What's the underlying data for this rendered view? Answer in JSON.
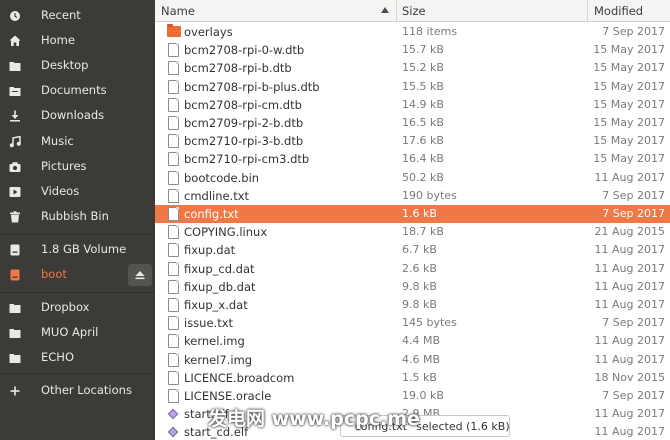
{
  "sidebar": {
    "items": [
      {
        "label": "Recent",
        "icon": "clock-icon"
      },
      {
        "label": "Home",
        "icon": "home-icon"
      },
      {
        "label": "Desktop",
        "icon": "folder-icon"
      },
      {
        "label": "Documents",
        "icon": "document-icon"
      },
      {
        "label": "Downloads",
        "icon": "download-icon"
      },
      {
        "label": "Music",
        "icon": "music-icon"
      },
      {
        "label": "Pictures",
        "icon": "camera-icon"
      },
      {
        "label": "Videos",
        "icon": "video-icon"
      },
      {
        "label": "Rubbish Bin",
        "icon": "trash-icon"
      },
      {
        "label": "1.8 GB Volume",
        "icon": "drive-icon"
      },
      {
        "label": "boot",
        "icon": "drive-icon"
      },
      {
        "label": "Dropbox",
        "icon": "folder-icon"
      },
      {
        "label": "MUO April",
        "icon": "folder-icon"
      },
      {
        "label": "ECHO",
        "icon": "folder-icon"
      },
      {
        "label": "Other Locations",
        "icon": "plus-icon"
      }
    ],
    "active_label": "boot",
    "accent_color": "#f07746"
  },
  "columns": {
    "name": "Name",
    "size": "Size",
    "modified": "Modified"
  },
  "files": [
    {
      "name": "overlays",
      "size": "118 items",
      "modified": "7 Sep 2017",
      "type": "folder"
    },
    {
      "name": "bcm2708-rpi-0-w.dtb",
      "size": "15.7 kB",
      "modified": "15 May 2017",
      "type": "doc"
    },
    {
      "name": "bcm2708-rpi-b.dtb",
      "size": "15.2 kB",
      "modified": "15 May 2017",
      "type": "doc"
    },
    {
      "name": "bcm2708-rpi-b-plus.dtb",
      "size": "15.5 kB",
      "modified": "15 May 2017",
      "type": "doc"
    },
    {
      "name": "bcm2708-rpi-cm.dtb",
      "size": "14.9 kB",
      "modified": "15 May 2017",
      "type": "doc"
    },
    {
      "name": "bcm2709-rpi-2-b.dtb",
      "size": "16.5 kB",
      "modified": "15 May 2017",
      "type": "doc"
    },
    {
      "name": "bcm2710-rpi-3-b.dtb",
      "size": "17.6 kB",
      "modified": "15 May 2017",
      "type": "doc"
    },
    {
      "name": "bcm2710-rpi-cm3.dtb",
      "size": "16.4 kB",
      "modified": "15 May 2017",
      "type": "doc"
    },
    {
      "name": "bootcode.bin",
      "size": "50.2 kB",
      "modified": "11 Aug 2017",
      "type": "doc"
    },
    {
      "name": "cmdline.txt",
      "size": "190 bytes",
      "modified": "7 Sep 2017",
      "type": "doc"
    },
    {
      "name": "config.txt",
      "size": "1.6 kB",
      "modified": "7 Sep 2017",
      "type": "doc",
      "selected": true
    },
    {
      "name": "COPYING.linux",
      "size": "18.7 kB",
      "modified": "21 Aug 2015",
      "type": "doc"
    },
    {
      "name": "fixup.dat",
      "size": "6.7 kB",
      "modified": "11 Aug 2017",
      "type": "doc"
    },
    {
      "name": "fixup_cd.dat",
      "size": "2.6 kB",
      "modified": "11 Aug 2017",
      "type": "doc"
    },
    {
      "name": "fixup_db.dat",
      "size": "9.8 kB",
      "modified": "11 Aug 2017",
      "type": "doc"
    },
    {
      "name": "fixup_x.dat",
      "size": "9.8 kB",
      "modified": "11 Aug 2017",
      "type": "doc"
    },
    {
      "name": "issue.txt",
      "size": "145 bytes",
      "modified": "7 Sep 2017",
      "type": "doc"
    },
    {
      "name": "kernel.img",
      "size": "4.4 MB",
      "modified": "11 Aug 2017",
      "type": "doc"
    },
    {
      "name": "kernel7.img",
      "size": "4.6 MB",
      "modified": "11 Aug 2017",
      "type": "doc"
    },
    {
      "name": "LICENCE.broadcom",
      "size": "1.5 kB",
      "modified": "18 Nov 2015",
      "type": "doc"
    },
    {
      "name": "LICENSE.oracle",
      "size": "19.0 kB",
      "modified": "7 Sep 2017",
      "type": "doc"
    },
    {
      "name": "start.elf",
      "size": "2.9 MB",
      "modified": "11 Aug 2017",
      "type": "exec"
    },
    {
      "name": "start_cd.elf",
      "size": "666.4 kB",
      "modified": "11 Aug 2017",
      "type": "exec"
    }
  ],
  "status_text": "“config.txt” selected (1.6 kB)",
  "watermark": "发电网 www.pcpc.me"
}
